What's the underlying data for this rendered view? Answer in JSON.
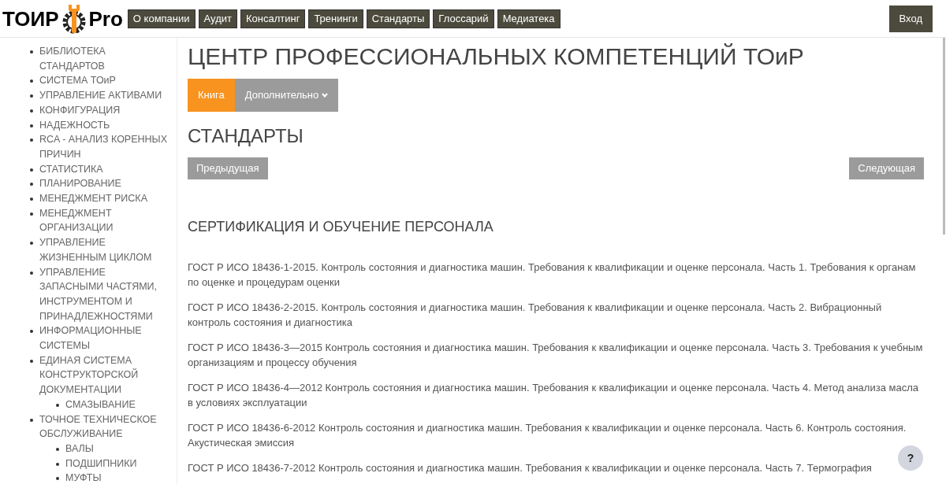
{
  "logo": {
    "left": "ТОИР",
    "right": "Pro"
  },
  "nav": [
    "О компании",
    "Аудит",
    "Консалтинг",
    "Тренинги",
    "Стандарты",
    "Глоссарий",
    "Медиатека"
  ],
  "login": "Вход",
  "sidebar": {
    "items": [
      {
        "label": "БИБЛИОТЕКА СТАНДАРТОВ"
      },
      {
        "label": "СИСТЕМА ТОиР"
      },
      {
        "label": "УПРАВЛЕНИЕ АКТИВАМИ"
      },
      {
        "label": "КОНФИГУРАЦИЯ"
      },
      {
        "label": "НАДЕЖНОСТЬ"
      },
      {
        "label": "RCA - АНАЛИЗ КОРЕННЫХ ПРИЧИН"
      },
      {
        "label": "СТАТИСТИКА"
      },
      {
        "label": "ПЛАНИРОВАНИЕ"
      },
      {
        "label": "МЕНЕДЖМЕНТ РИСКА"
      },
      {
        "label": "МЕНЕДЖМЕНТ ОРГАНИЗАЦИИ"
      },
      {
        "label": "УПРАВЛЕНИЕ ЖИЗНЕННЫМ ЦИКЛОМ"
      },
      {
        "label": "УПРАВЛЕНИЕ ЗАПАСНЫМИ ЧАСТЯМИ, ИНСТРУМЕНТОМ И ПРИНАДЛЕЖНОСТЯМИ"
      },
      {
        "label": "ИНФОРМАЦИОННЫЕ СИСТЕМЫ"
      },
      {
        "label": "ЕДИНАЯ СИСТЕМА КОНСТРУКТОРСКОЙ ДОКУМЕНТАЦИИ",
        "children": [
          {
            "label": "СМАЗЫВАНИЕ"
          }
        ]
      },
      {
        "label": "ТОЧНОЕ ТЕХНИЧЕСКОЕ ОБСЛУЖИВАНИЕ",
        "children": [
          {
            "label": "ВАЛЫ"
          },
          {
            "label": "ПОДШИПНИКИ"
          },
          {
            "label": "МУФТЫ"
          }
        ]
      }
    ]
  },
  "page_title": "ЦЕНТР ПРОФЕССИОНАЛЬНЫХ КОМПЕТЕНЦИЙ ТОиР",
  "tabs": [
    {
      "label": "Книга",
      "selected": true,
      "kind": "tab"
    },
    {
      "label": "Дополнительно",
      "selected": false,
      "kind": "dropdown"
    }
  ],
  "section_title": "СТАНДАРТЫ",
  "pager": {
    "prev": "Предыдущая",
    "next": "Следующая"
  },
  "subsection_title": "СЕРТИФИКАЦИЯ И ОБУЧЕНИЕ ПЕРСОНАЛА",
  "documents": [
    "ГОСТ Р ИСО 18436-1-2015. Контроль состояния и диагностика машин. Требования к квалификации и оценке персонала. Часть 1. Требования к органам по оценке и процедурам оценки",
    "ГОСТ Р ИСО 18436-2-2015. Контроль состояния и диагностика машин. Требования к квалификации и оценке персонала. Часть 2. Вибрационный контроль состояния и диагностика",
    "ГОСТ Р ИСО 18436-3—2015 Контроль состояния и диагностика машин. Требования к квалификации и оценке персонала. Часть 3. Требования к учебным организациям и процессу обучения",
    "ГОСТ Р ИСО 18436-4—2012 Контроль состояния и диагностика машин. Требования к квалификации и оценке персонала. Часть 4. Метод анализа масла в условиях эксплуатации",
    "ГОСТ Р ИСО 18436-6-2012 Контроль состояния и диагностика машин. Требования к квалификации и оценке персонала. Часть 6. Контроль состояния. Акустическая эмиссия",
    "ГОСТ Р ИСО 18436-7-2012 Контроль состояния и диагностика машин. Требования к квалификации и оценке персонала. Часть 7. Термография"
  ],
  "help": "?"
}
